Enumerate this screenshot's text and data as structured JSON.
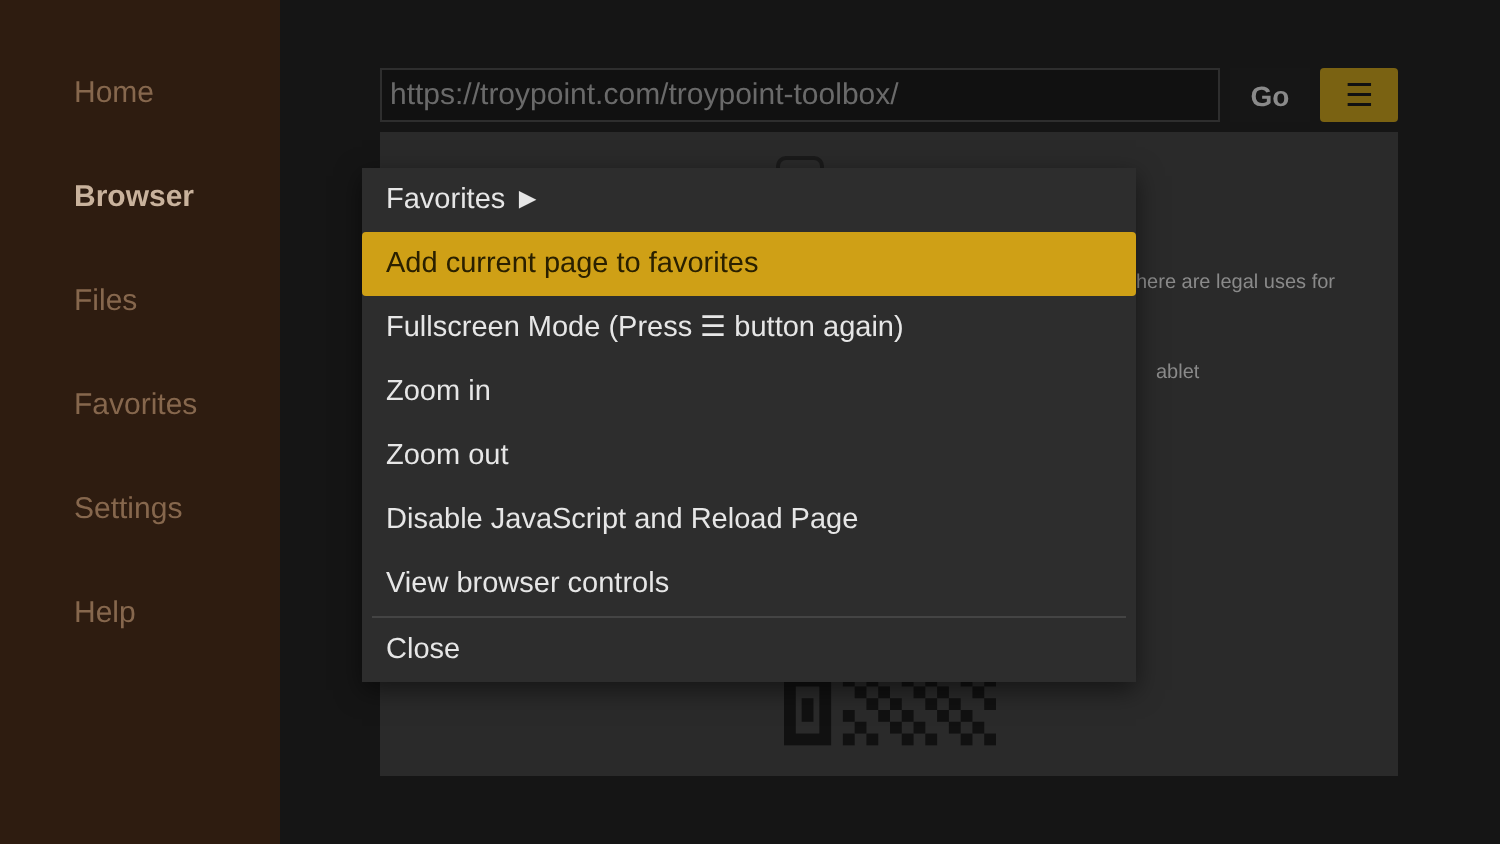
{
  "sidebar": {
    "items": [
      {
        "label": "Home",
        "selected": false
      },
      {
        "label": "Browser",
        "selected": true
      },
      {
        "label": "Files",
        "selected": false
      },
      {
        "label": "Favorites",
        "selected": false
      },
      {
        "label": "Settings",
        "selected": false
      },
      {
        "label": "Help",
        "selected": false
      }
    ]
  },
  "toolbar": {
    "url": "https://troypoint.com/troypoint-toolbox/",
    "go_button": "Go",
    "menu_button": "☰"
  },
  "page": {
    "texts": [
      "here are legal uses for",
      "ablet"
    ]
  },
  "menu": {
    "items": [
      {
        "label": "Favorites ►",
        "selected": false,
        "divider_before": false
      },
      {
        "label": "Add current page to favorites",
        "selected": true,
        "divider_before": false
      },
      {
        "label": "Fullscreen Mode (Press ☰ button again)",
        "selected": false,
        "divider_before": false
      },
      {
        "label": "Zoom in",
        "selected": false,
        "divider_before": false
      },
      {
        "label": "Zoom out",
        "selected": false,
        "divider_before": false
      },
      {
        "label": "Disable JavaScript and Reload Page",
        "selected": false,
        "divider_before": false
      },
      {
        "label": "View browser controls",
        "selected": false,
        "divider_before": false
      },
      {
        "label": "Close",
        "selected": false,
        "divider_before": true
      }
    ]
  }
}
